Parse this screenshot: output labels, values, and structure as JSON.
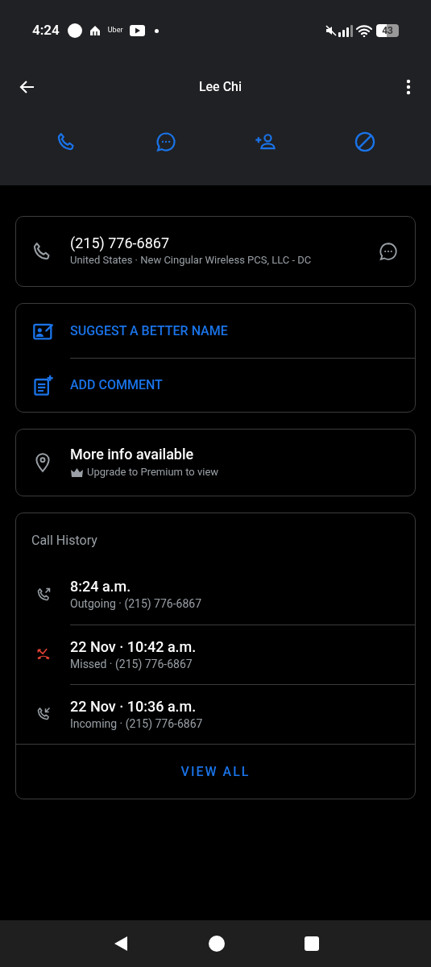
{
  "status_bar": {
    "time": "4:24",
    "app_label": "Uber",
    "battery": "43"
  },
  "app_bar": {
    "title": "Lee Chi"
  },
  "actions": [
    {
      "kind": "call"
    },
    {
      "kind": "message"
    },
    {
      "kind": "add_contact"
    },
    {
      "kind": "block"
    }
  ],
  "number_card": {
    "number": "(215) 776-6867",
    "details": "United States · New Cingular Wireless PCS, LLC - DC"
  },
  "options": [
    {
      "kind": "suggest",
      "label": "SUGGEST A BETTER NAME"
    },
    {
      "kind": "comment",
      "label": "ADD COMMENT"
    }
  ],
  "info_card": {
    "title": "More info available",
    "subtitle": "Upgrade to Premium to view"
  },
  "call_history": {
    "title": "Call History",
    "calls": [
      {
        "kind": "outgoing",
        "time": "8:24 a.m.",
        "detail": "Outgoing · (215) 776-6867"
      },
      {
        "kind": "missed",
        "time": "22 Nov · 10:42 a.m.",
        "detail": "Missed · (215) 776-6867"
      },
      {
        "kind": "incoming",
        "time": "22 Nov · 10:36 a.m.",
        "detail": "Incoming · (215) 776-6867"
      }
    ],
    "view_all": "VIEW ALL"
  }
}
